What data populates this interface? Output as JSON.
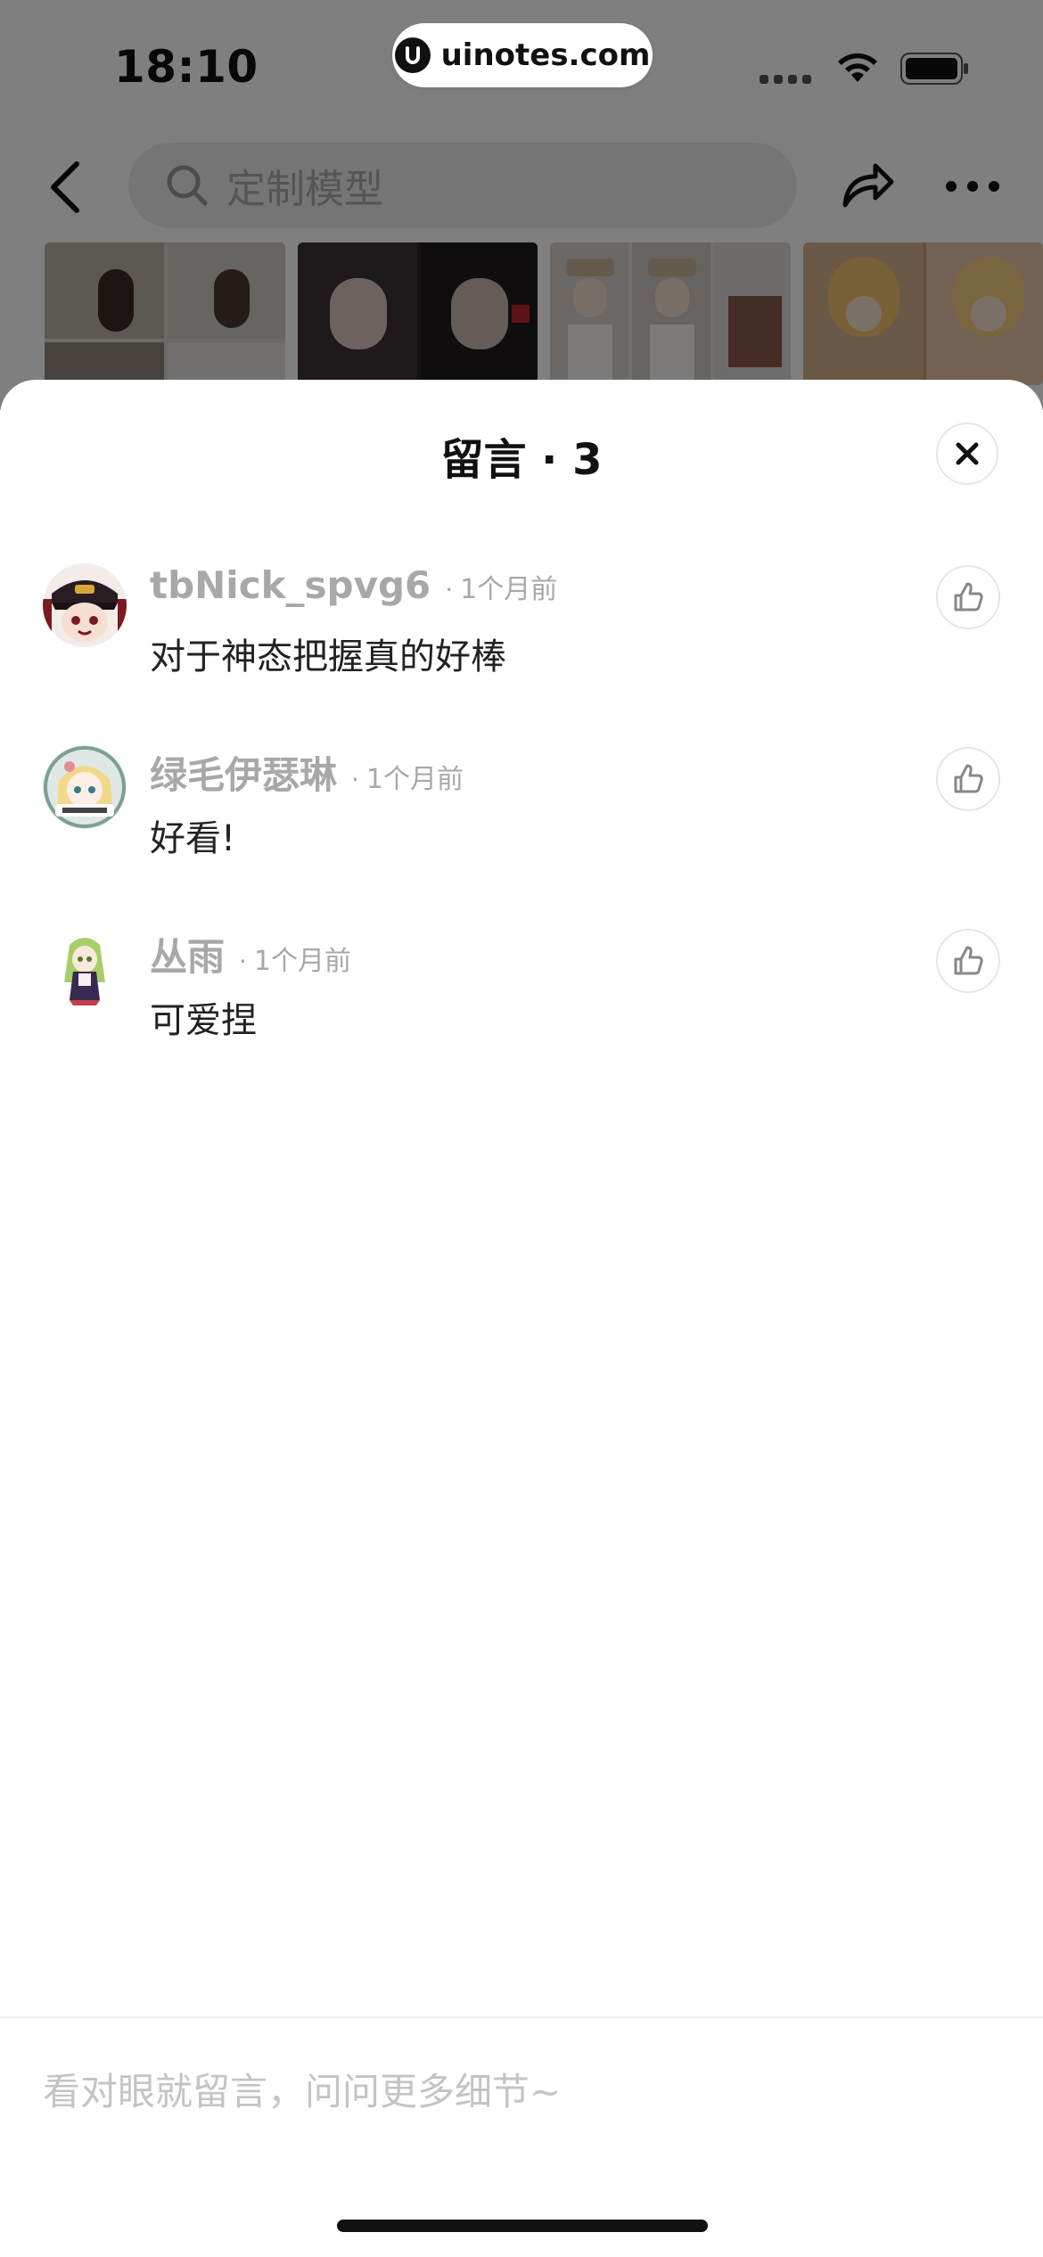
{
  "status_bar": {
    "time": "18:10",
    "url": "uinotes.com"
  },
  "nav": {
    "search_placeholder": "定制模型",
    "icons": [
      "back-icon",
      "search-icon",
      "share-icon",
      "more-icon"
    ]
  },
  "sheet": {
    "title": "留言 · 3",
    "close_icon": "close-icon"
  },
  "comments": [
    {
      "username": "tbNick_spvg6",
      "time": "1个月前",
      "text": "对于神态把握真的好棒"
    },
    {
      "username": "绿毛伊瑟琳",
      "time": "1个月前",
      "text": "好看!"
    },
    {
      "username": "丛雨",
      "time": "1个月前",
      "text": "可爱捏"
    }
  ],
  "input": {
    "placeholder": "看对眼就留言，问问更多细节~"
  },
  "colors": {
    "accent_text": "#111111",
    "muted_text": "#a8a8a8",
    "overlay": "rgba(0,0,0,0.5)"
  }
}
